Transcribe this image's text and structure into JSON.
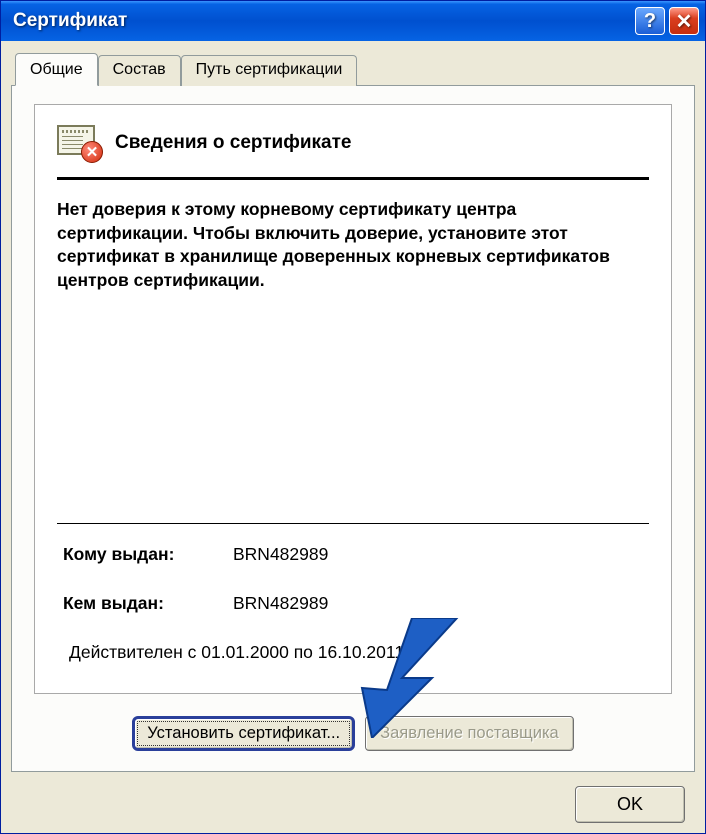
{
  "window": {
    "title": "Сертификат"
  },
  "tabs": {
    "general": "Общие",
    "details": "Состав",
    "path": "Путь сертификации"
  },
  "cert": {
    "heading": "Сведения о сертификате",
    "warning": "Нет доверия к этому корневому сертификату центра сертификации. Чтобы включить доверие, установите этот сертификат в хранилище доверенных корневых сертификатов центров сертификации.",
    "issued_to_label": "Кому выдан:",
    "issued_to_value": "BRN482989",
    "issued_by_label": "Кем выдан:",
    "issued_by_value": "BRN482989",
    "validity": "Действителен с 01.01.2000 по 16.10.2011"
  },
  "buttons": {
    "install": "Установить сертификат...",
    "issuer_statement": "Заявление поставщика",
    "ok": "OK"
  }
}
